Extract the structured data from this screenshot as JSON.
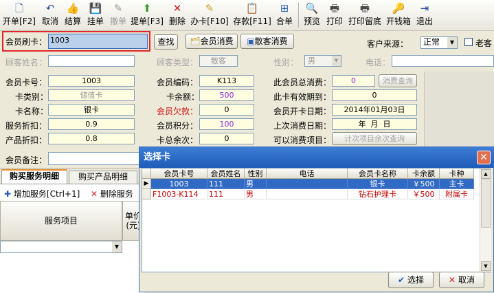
{
  "toolbar": {
    "items": [
      {
        "icon": "🗋",
        "label": "开单[F2]"
      },
      {
        "icon": "↶",
        "label": "取消"
      },
      {
        "icon": "👍",
        "label": "结算"
      },
      {
        "icon": "💾",
        "label": "挂单"
      },
      {
        "icon": "✎",
        "label": "撤单"
      },
      {
        "icon": "⬆",
        "label": "提单[F3]"
      },
      {
        "icon": "✕",
        "label": "删除"
      },
      {
        "icon": "✎",
        "label": "办卡[F10]"
      },
      {
        "icon": "📋",
        "label": "存款[F11]"
      },
      {
        "icon": "⊞",
        "label": "合单"
      },
      {
        "icon": "🔍",
        "label": "预览"
      },
      {
        "icon": "🖶",
        "label": "打印"
      },
      {
        "icon": "🖶",
        "label": "打印留底"
      },
      {
        "icon": "🔑",
        "label": "开钱箱"
      },
      {
        "icon": "⇥",
        "label": "退出"
      }
    ]
  },
  "search": {
    "card_label": "会员刷卡：",
    "card_value": "1003",
    "find_button": "查找",
    "member_consume_button": "会员消费",
    "guest_consume_button": "散客消费",
    "source_label": "客户来源：",
    "source_value": "正常",
    "old_customer_label": "老客"
  },
  "guest_row": {
    "name_label": "顾客姓名：",
    "type_label": "顾客类型：",
    "type_value": "散客",
    "gender_label": "性别：",
    "gender_value": "男",
    "phone_label": "电话："
  },
  "member": {
    "card_no_label": "会员卡号：",
    "card_no": "1003",
    "card_type_label": "卡类别：",
    "card_type": "储值卡",
    "card_name_label": "卡名称：",
    "card_name": "银卡",
    "service_discount_label": "服务折扣：",
    "service_discount": "0.9",
    "product_discount_label": "产品折扣：",
    "product_discount": "0.8",
    "code_label": "会员编码：",
    "code": "K113",
    "balance_label": "卡余额：",
    "balance": "500",
    "debt_label": "会员欠款：",
    "debt": "0",
    "points_label": "会员积分：",
    "points": "100",
    "remaining_label": "卡总余次：",
    "remaining": "0",
    "total_spend_label": "此会员总消费：",
    "total_spend": "0",
    "consume_query_button": "消费查询",
    "valid_label": "此卡有效期到：",
    "valid": "0",
    "open_date_label": "会员开卡日期：",
    "open_date": "2014年01月03日",
    "last_date_label": "上次消费日期：",
    "last_date": "年  月  日",
    "items_label": "可以消费项目：",
    "items_button": "计次项目余次查询",
    "remark_label": "会员备注："
  },
  "tabs": [
    "购买服务明细",
    "购买产品明细"
  ],
  "service_toolbar": {
    "add_label": "增加服务[Ctrl+1]",
    "delete_label": "删除服务"
  },
  "service_grid": {
    "col_item": "服务项目",
    "col_price": "单价\n(元)"
  },
  "dialog": {
    "title": "选择卡",
    "headers": [
      "会员卡号",
      "会员姓名",
      "性别",
      "电话",
      "会员卡名称",
      "卡余额",
      "卡种"
    ],
    "rows": [
      [
        "1003",
        "111",
        "男",
        "",
        "银卡",
        "￥500",
        "主卡"
      ],
      [
        "F1003-K114",
        "111",
        "男",
        "",
        "钻石护理卡",
        "￥500",
        "附属卡"
      ]
    ],
    "ok_button": "选择",
    "cancel_button": "取消"
  }
}
